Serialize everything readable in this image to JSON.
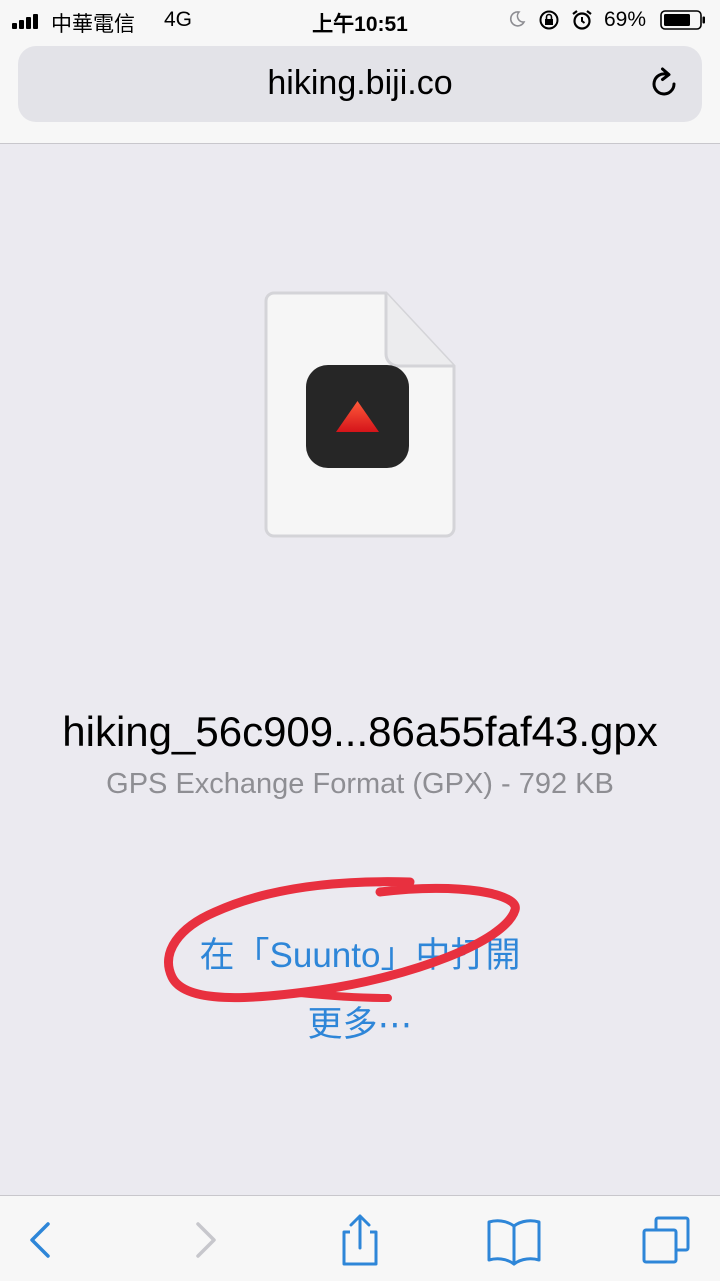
{
  "status_bar": {
    "carrier": "中華電信",
    "network": "4G",
    "time": "上午10:51",
    "battery": "69%"
  },
  "url_bar": {
    "domain": "hiking.biji.co"
  },
  "file": {
    "name": "hiking_56c909...86a55faf43.gpx",
    "info": "GPS Exchange Format (GPX) - 792 KB",
    "app_icon": "suunto-app-icon"
  },
  "actions": {
    "open_in": "在「Suunto」中打開",
    "more": "更多⋯"
  },
  "toolbar": {
    "back": "chevron-left-icon",
    "forward": "chevron-right-icon",
    "share": "share-icon",
    "bookmarks": "book-icon",
    "tabs": "tabs-icon"
  },
  "colors": {
    "accent": "#2e86d8",
    "annotation": "#e8303f",
    "background": "#ebeaf0"
  }
}
